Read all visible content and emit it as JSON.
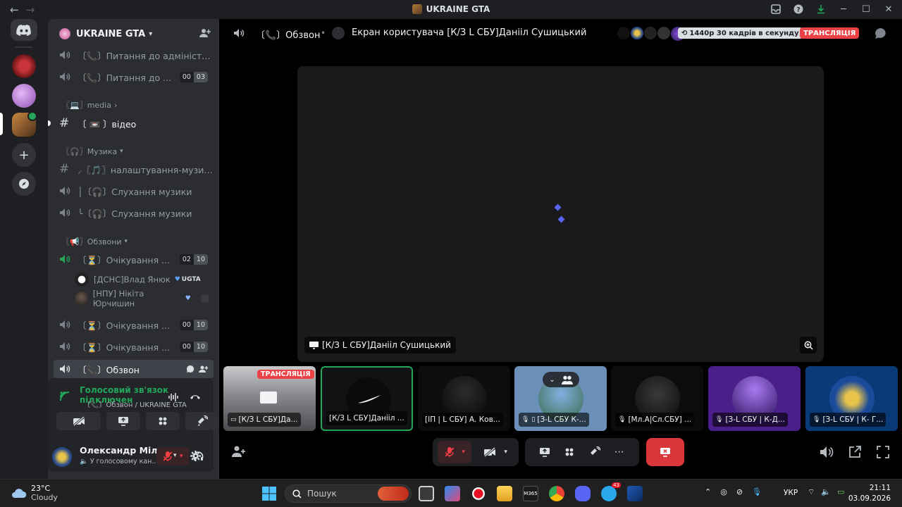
{
  "window": {
    "title": "UKRAINE GTA"
  },
  "server": {
    "name": "UKRAINE GTA"
  },
  "channels": {
    "admin_q1": "〔📞〕Питання до адміністрації",
    "admin_q2": "〔📞〕Питання до ...",
    "admin_q2_counts": [
      "00",
      "03"
    ],
    "cat_media": "〖💻〗media",
    "video": "〔 📼 〕відео",
    "cat_music": "〖🎧〗Музика",
    "music_settings": "⸝〖🎵〗налаштування-музики",
    "music1": "│〔🎧〕Слухання музики",
    "music2": "╰〔🎧〕Слухання музики",
    "cat_calls": "〖📢〗Обзвони",
    "wait1": "〔⏳〕Очікування ...",
    "wait1_counts": [
      "02",
      "10"
    ],
    "wait2": "〔⏳〕Очікування ...",
    "wait2_counts": [
      "00",
      "10"
    ],
    "wait3": "〔⏳〕Очікування ...",
    "wait3_counts": [
      "00",
      "10"
    ],
    "obzvon": "〔📞〕Обзвон"
  },
  "members": [
    {
      "name": "[ДСНС]Влад Янюк",
      "tag": "UGTA"
    },
    {
      "name": "[НПУ] Нікіта Юрчишин"
    }
  ],
  "voice": {
    "status": "Голосовий зв'язок підключен",
    "location": "〔📞〕Обзвон / UKRAINE GTA"
  },
  "user": {
    "name": "Олександр Міл...",
    "status": "У голосовому кан..."
  },
  "main": {
    "channel": "〔📞〕Обзвон",
    "stream_title": "Екран користувача [К/З L СБУ]Данііл Сушицький",
    "quality": "1440p 30 кадрів в секунду",
    "live": "ТРАНСЛЯЦІЯ",
    "stage_name": "[К/З L СБУ]Данііл Сушицький"
  },
  "tiles": [
    {
      "name": "[К/З L СБУ]Да...",
      "live": "ТРАНСЛЯЦІЯ"
    },
    {
      "name": "[К/З L СБУ]Данііл ..."
    },
    {
      "name": "[ІП | L СБУ] А. Ков..."
    },
    {
      "name": "[З-L СБУ К-..."
    },
    {
      "name": "[Мл.А|Сл.СБУ] ..."
    },
    {
      "name": "[З-L СБУ | К-Д..."
    },
    {
      "name": "[З-L СБУ | К- Г..."
    }
  ],
  "taskbar": {
    "temp": "23°C",
    "weather": "Cloudy",
    "search": "Пошук",
    "lang": "УКР",
    "time": "21:11",
    "date": "03.09.2026",
    "telegram_badge": "43"
  },
  "colors": {
    "accent": "#5865f2",
    "green": "#23a55a",
    "red": "#ed4245",
    "hangup": "#da373c"
  }
}
